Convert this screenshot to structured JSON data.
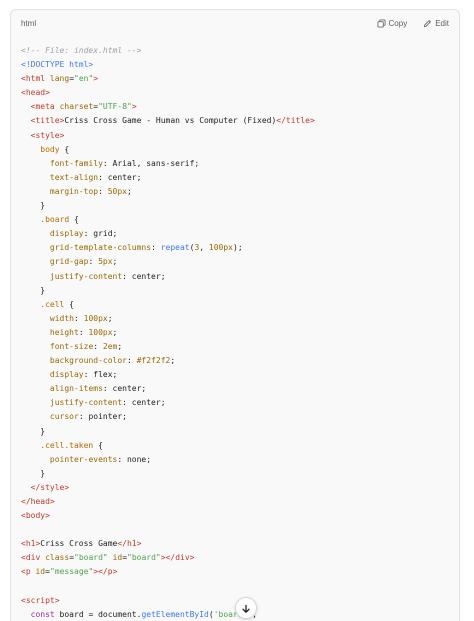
{
  "code_block": {
    "language": "html",
    "copy_label": "Copy",
    "edit_label": "Edit",
    "lines": [
      [
        [
          "c",
          "<!-- File: index.html -->"
        ]
      ],
      [
        [
          "d",
          "<!DOCTYPE html>"
        ]
      ],
      [
        [
          "t",
          "<html"
        ],
        [
          "p",
          " "
        ],
        [
          "a",
          "lang"
        ],
        [
          "p",
          "="
        ],
        [
          "s",
          "\"en\""
        ],
        [
          "t",
          ">"
        ]
      ],
      [
        [
          "t",
          "<head>"
        ]
      ],
      [
        [
          "p",
          "  "
        ],
        [
          "t",
          "<meta"
        ],
        [
          "p",
          " "
        ],
        [
          "a",
          "charset"
        ],
        [
          "p",
          "="
        ],
        [
          "s",
          "\"UTF-8\""
        ],
        [
          "t",
          ">"
        ]
      ],
      [
        [
          "p",
          "  "
        ],
        [
          "t",
          "<title>"
        ],
        [
          "p",
          "Criss Cross Game - Human vs Computer (Fixed)"
        ],
        [
          "t",
          "</title>"
        ]
      ],
      [
        [
          "p",
          "  "
        ],
        [
          "t",
          "<style>"
        ]
      ],
      [
        [
          "p",
          "    "
        ],
        [
          "sel",
          "body"
        ],
        [
          "p",
          " {"
        ]
      ],
      [
        [
          "p",
          "      "
        ],
        [
          "prop",
          "font-family"
        ],
        [
          "p",
          ": Arial, sans-serif;"
        ]
      ],
      [
        [
          "p",
          "      "
        ],
        [
          "prop",
          "text-align"
        ],
        [
          "p",
          ": center;"
        ]
      ],
      [
        [
          "p",
          "      "
        ],
        [
          "prop",
          "margin-top"
        ],
        [
          "p",
          ": "
        ],
        [
          "num",
          "50px"
        ],
        [
          "p",
          ";"
        ]
      ],
      [
        [
          "p",
          "    }"
        ]
      ],
      [
        [
          "p",
          "    "
        ],
        [
          "sel",
          ".board"
        ],
        [
          "p",
          " {"
        ]
      ],
      [
        [
          "p",
          "      "
        ],
        [
          "prop",
          "display"
        ],
        [
          "p",
          ": grid;"
        ]
      ],
      [
        [
          "p",
          "      "
        ],
        [
          "prop",
          "grid-template-columns"
        ],
        [
          "p",
          ": "
        ],
        [
          "fn",
          "repeat"
        ],
        [
          "p",
          "("
        ],
        [
          "num",
          "3"
        ],
        [
          "p",
          ", "
        ],
        [
          "num",
          "100px"
        ],
        [
          "p",
          ");"
        ]
      ],
      [
        [
          "p",
          "      "
        ],
        [
          "prop",
          "grid-gap"
        ],
        [
          "p",
          ": "
        ],
        [
          "num",
          "5px"
        ],
        [
          "p",
          ";"
        ]
      ],
      [
        [
          "p",
          "      "
        ],
        [
          "prop",
          "justify-content"
        ],
        [
          "p",
          ": center;"
        ]
      ],
      [
        [
          "p",
          "    }"
        ]
      ],
      [
        [
          "p",
          "    "
        ],
        [
          "sel",
          ".cell"
        ],
        [
          "p",
          " {"
        ]
      ],
      [
        [
          "p",
          "      "
        ],
        [
          "prop",
          "width"
        ],
        [
          "p",
          ": "
        ],
        [
          "num",
          "100px"
        ],
        [
          "p",
          ";"
        ]
      ],
      [
        [
          "p",
          "      "
        ],
        [
          "prop",
          "height"
        ],
        [
          "p",
          ": "
        ],
        [
          "num",
          "100px"
        ],
        [
          "p",
          ";"
        ]
      ],
      [
        [
          "p",
          "      "
        ],
        [
          "prop",
          "font-size"
        ],
        [
          "p",
          ": "
        ],
        [
          "num",
          "2em"
        ],
        [
          "p",
          ";"
        ]
      ],
      [
        [
          "p",
          "      "
        ],
        [
          "prop",
          "background-color"
        ],
        [
          "p",
          ": "
        ],
        [
          "num",
          "#f2f2f2"
        ],
        [
          "p",
          ";"
        ]
      ],
      [
        [
          "p",
          "      "
        ],
        [
          "prop",
          "display"
        ],
        [
          "p",
          ": flex;"
        ]
      ],
      [
        [
          "p",
          "      "
        ],
        [
          "prop",
          "align-items"
        ],
        [
          "p",
          ": center;"
        ]
      ],
      [
        [
          "p",
          "      "
        ],
        [
          "prop",
          "justify-content"
        ],
        [
          "p",
          ": center;"
        ]
      ],
      [
        [
          "p",
          "      "
        ],
        [
          "prop",
          "cursor"
        ],
        [
          "p",
          ": pointer;"
        ]
      ],
      [
        [
          "p",
          "    }"
        ]
      ],
      [
        [
          "p",
          "    "
        ],
        [
          "sel",
          ".cell.taken"
        ],
        [
          "p",
          " {"
        ]
      ],
      [
        [
          "p",
          "      "
        ],
        [
          "prop",
          "pointer-events"
        ],
        [
          "p",
          ": none;"
        ]
      ],
      [
        [
          "p",
          "    }"
        ]
      ],
      [
        [
          "p",
          "  "
        ],
        [
          "t",
          "</style>"
        ]
      ],
      [
        [
          "t",
          "</head>"
        ]
      ],
      [
        [
          "t",
          "<body>"
        ]
      ],
      [],
      [
        [
          "t",
          "<h1>"
        ],
        [
          "p",
          "Criss Cross Game"
        ],
        [
          "t",
          "</h1>"
        ]
      ],
      [
        [
          "t",
          "<div"
        ],
        [
          "p",
          " "
        ],
        [
          "a",
          "class"
        ],
        [
          "p",
          "="
        ],
        [
          "s",
          "\"board\""
        ],
        [
          "p",
          " "
        ],
        [
          "a",
          "id"
        ],
        [
          "p",
          "="
        ],
        [
          "s",
          "\"board\""
        ],
        [
          "t",
          "></div>"
        ]
      ],
      [
        [
          "t",
          "<p"
        ],
        [
          "p",
          " "
        ],
        [
          "a",
          "id"
        ],
        [
          "p",
          "="
        ],
        [
          "s",
          "\"message\""
        ],
        [
          "t",
          "></p>"
        ]
      ],
      [],
      [
        [
          "t",
          "<script>"
        ]
      ],
      [
        [
          "p",
          "  "
        ],
        [
          "kw",
          "const"
        ],
        [
          "p",
          " board = document."
        ],
        [
          "fn",
          "getElementById"
        ],
        [
          "p",
          "("
        ],
        [
          "s",
          "'board'"
        ],
        [
          "p",
          ");"
        ]
      ]
    ]
  },
  "icons": {
    "copy": "copy-icon",
    "edit": "edit-icon",
    "scroll": "arrow-down-icon"
  },
  "colors": {
    "code_background": "#f9f9f9",
    "border": "#e3e3e3",
    "tag": "#c0392b",
    "attribute": "#986801",
    "string": "#50a14f",
    "comment": "#a0a1a7",
    "doctype": "#4078f2",
    "keyword": "#a626a4"
  }
}
